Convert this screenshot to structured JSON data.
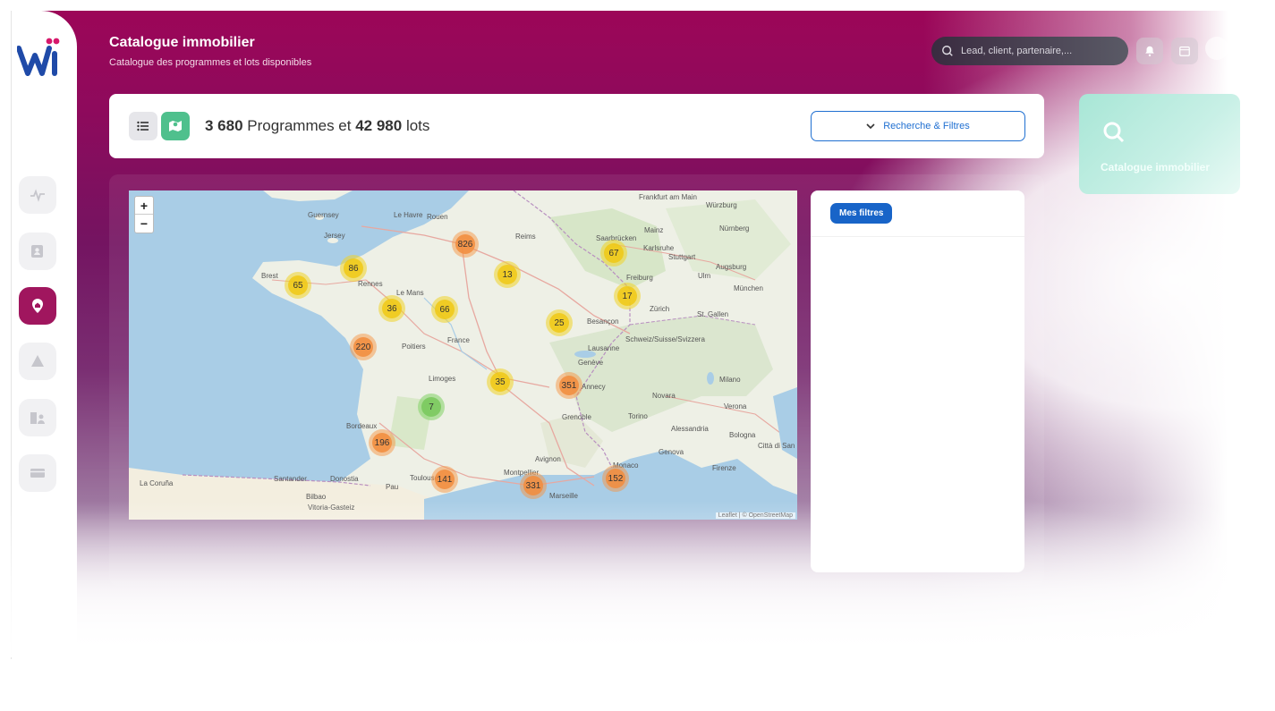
{
  "header": {
    "title": "Catalogue immobilier",
    "subtitle": "Catalogue des programmes et lots disponibles",
    "search_placeholder": "Lead, client, partenaire,..."
  },
  "summary": {
    "programmes_count": "3 680",
    "programmes_label": "Programmes et",
    "lots_count": "42 980",
    "lots_label": "lots"
  },
  "filters_button": {
    "label": "Recherche & Filtres"
  },
  "filters_panel": {
    "chip_label": "Mes filtres"
  },
  "side_card": {
    "label": "Catalogue immobilier"
  },
  "map": {
    "zoom_in": "+",
    "zoom_out": "−",
    "attribution": "Leaflet | © OpenStreetMap",
    "clusters": [
      {
        "count": "826",
        "color": "orange"
      },
      {
        "count": "67",
        "color": "yellow"
      },
      {
        "count": "86",
        "color": "yellow"
      },
      {
        "count": "13",
        "color": "yellow"
      },
      {
        "count": "65",
        "color": "yellow"
      },
      {
        "count": "17",
        "color": "yellow"
      },
      {
        "count": "36",
        "color": "yellow"
      },
      {
        "count": "66",
        "color": "yellow"
      },
      {
        "count": "25",
        "color": "yellow"
      },
      {
        "count": "220",
        "color": "orange"
      },
      {
        "count": "35",
        "color": "yellow"
      },
      {
        "count": "351",
        "color": "orange"
      },
      {
        "count": "7",
        "color": "green"
      },
      {
        "count": "196",
        "color": "orange"
      },
      {
        "count": "141",
        "color": "orange"
      },
      {
        "count": "152",
        "color": "orange"
      },
      {
        "count": "331",
        "color": "orange"
      }
    ],
    "cities": [
      "Guernsey",
      "Jersey",
      "Le Havre",
      "Rouen",
      "Reims",
      "Frankfurt am Main",
      "Mainz",
      "Würzburg",
      "Nürnberg",
      "Saarbrücken",
      "Karlsruhe",
      "Stuttgart",
      "Augsburg",
      "München",
      "Brest",
      "Rennes",
      "Le Mans",
      "Freiburg",
      "Ulm",
      "Zürich",
      "St. Gallen",
      "Besançon",
      "Schweiz/Suisse/Svizzera",
      "Lausanne",
      "Genève",
      "Poitiers",
      "France",
      "Limoges",
      "Annecy",
      "Milano",
      "Verona",
      "Novara",
      "Torino",
      "Genova",
      "Bologna",
      "Bordeaux",
      "Grenoble",
      "Alessandria",
      "Toulouse",
      "Montpellier",
      "Marseille",
      "Monaco",
      "Firenze",
      "Città di San Marino",
      "La Coruña",
      "Santander",
      "Bilbao",
      "Pau",
      "Avignon",
      "Vitoria-Gasteiz",
      "Donostia"
    ]
  },
  "colors": {
    "brand": "#9c0658",
    "active_nav": "#a0165e",
    "map_view_button": "#4fc08d",
    "accent_blue": "#1f6fd1"
  },
  "icons": {
    "nav": [
      "activity-icon",
      "contact-card-icon",
      "home-pin-icon",
      "triangle-icon",
      "building-person-icon",
      "card-icon"
    ]
  }
}
